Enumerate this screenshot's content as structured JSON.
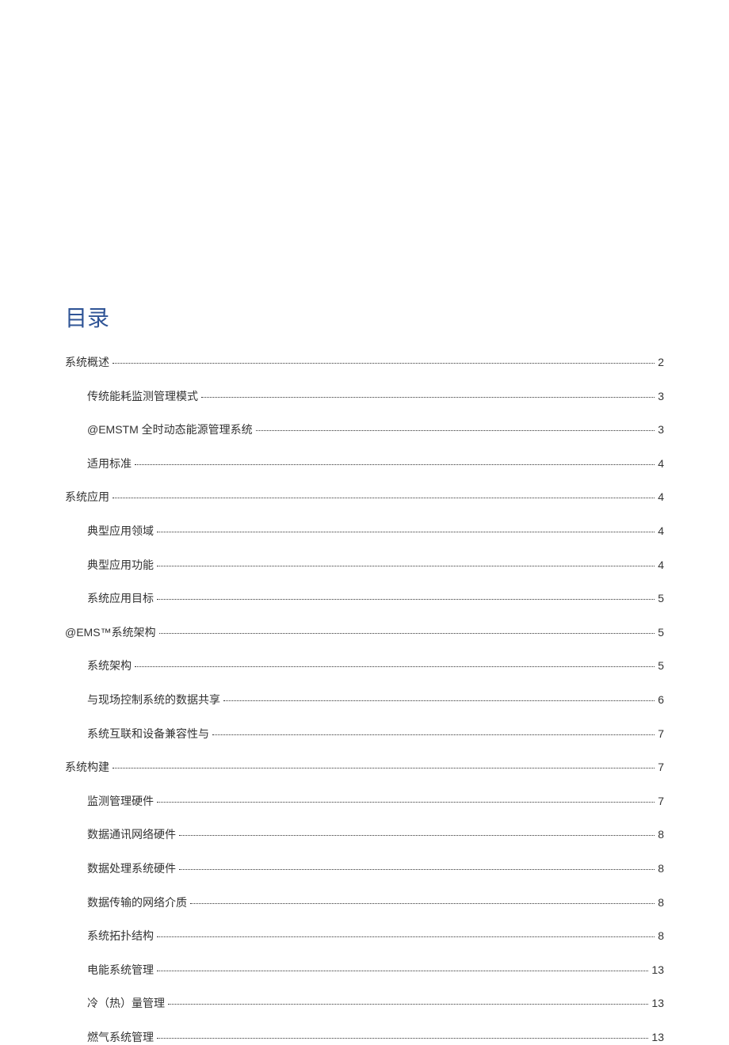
{
  "title": "目录",
  "entries": [
    {
      "level": 1,
      "label": "系统概述",
      "page": "2"
    },
    {
      "level": 2,
      "label": "传统能耗监测管理模式",
      "page": "3"
    },
    {
      "level": 2,
      "label": "@EMSTM 全时动态能源管理系统",
      "page": "3"
    },
    {
      "level": 2,
      "label": "适用标准",
      "page": "4"
    },
    {
      "level": 1,
      "label": "系统应用",
      "page": "4"
    },
    {
      "level": 2,
      "label": "典型应用领域",
      "page": "4"
    },
    {
      "level": 2,
      "label": "典型应用功能",
      "page": "4"
    },
    {
      "level": 2,
      "label": "系统应用目标",
      "page": "5"
    },
    {
      "level": 1,
      "label": "@EMS™系统架构",
      "page": "5"
    },
    {
      "level": 2,
      "label": "系统架构",
      "page": "5"
    },
    {
      "level": 2,
      "label": "与现场控制系统的数据共享",
      "page": "6"
    },
    {
      "level": 2,
      "label": "系统互联和设备兼容性与",
      "page": "7"
    },
    {
      "level": 1,
      "label": "系统构建",
      "page": "7"
    },
    {
      "level": 2,
      "label": "监测管理硬件",
      "page": "7"
    },
    {
      "level": 2,
      "label": "数据通讯网络硬件",
      "page": "8"
    },
    {
      "level": 2,
      "label": "数据处理系统硬件",
      "page": "8"
    },
    {
      "level": 2,
      "label": "数据传输的网络介质",
      "page": "8"
    },
    {
      "level": 2,
      "label": "系统拓扑结构",
      "page": "8"
    },
    {
      "level": 2,
      "label": "电能系统管理",
      "page": "13"
    },
    {
      "level": 2,
      "label": "冷（热）量管理",
      "page": "13"
    },
    {
      "level": 2,
      "label": "燃气系统管理",
      "page": "13"
    }
  ]
}
